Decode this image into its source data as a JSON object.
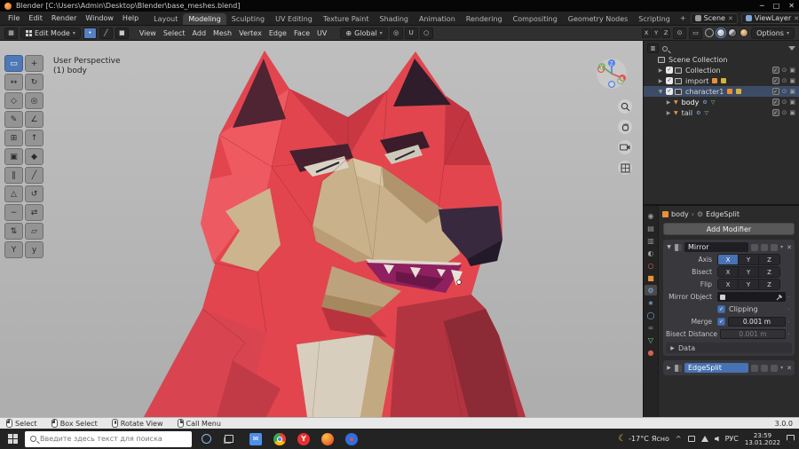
{
  "window": {
    "title": "Blender [C:\\Users\\Admin\\Desktop\\Blender\\base_meshes.blend]",
    "minimize": "─",
    "maximize": "□",
    "close": "✕"
  },
  "topbar": {
    "menus": [
      "File",
      "Edit",
      "Render",
      "Window",
      "Help"
    ],
    "workspaces": [
      "Layout",
      "Modeling",
      "Sculpting",
      "UV Editing",
      "Texture Paint",
      "Shading",
      "Animation",
      "Rendering",
      "Compositing",
      "Geometry Nodes",
      "Scripting"
    ],
    "active_workspace": "Modeling",
    "add_tab": "+",
    "scene_label": "Scene",
    "viewlayer_label": "ViewLayer"
  },
  "header": {
    "mode": "Edit Mode",
    "menus": [
      "View",
      "Select",
      "Add",
      "Mesh",
      "Vertex",
      "Edge",
      "Face",
      "UV"
    ],
    "orientation": "Global",
    "mirror_axes": [
      "X",
      "Y",
      "Z"
    ],
    "options_label": "Options"
  },
  "viewport": {
    "overlay_line1": "User Perspective",
    "overlay_line2": "(1) body"
  },
  "tools": [
    {
      "name": "select-box",
      "glyph": "▭",
      "active": true
    },
    {
      "name": "cursor",
      "glyph": "+"
    },
    {
      "name": "move",
      "glyph": "↔"
    },
    {
      "name": "rotate",
      "glyph": "↻"
    },
    {
      "name": "scale",
      "glyph": "◇"
    },
    {
      "name": "transform",
      "glyph": "◎"
    },
    {
      "name": "annotate",
      "glyph": "✎"
    },
    {
      "name": "measure",
      "glyph": "∠"
    },
    {
      "name": "add-cube",
      "glyph": "⊞"
    },
    {
      "name": "extrude",
      "glyph": "↑"
    },
    {
      "name": "inset",
      "glyph": "▣"
    },
    {
      "name": "bevel",
      "glyph": "◆"
    },
    {
      "name": "loop-cut",
      "glyph": "‖"
    },
    {
      "name": "knife",
      "glyph": "╱"
    },
    {
      "name": "poly-build",
      "glyph": "△"
    },
    {
      "name": "spin",
      "glyph": "↺"
    },
    {
      "name": "smooth",
      "glyph": "∼"
    },
    {
      "name": "edge-slide",
      "glyph": "⇄"
    },
    {
      "name": "shrink-fatten",
      "glyph": "⇅"
    },
    {
      "name": "shear",
      "glyph": "▱"
    },
    {
      "name": "rip-region",
      "glyph": "Y"
    },
    {
      "name": "rip-edge",
      "glyph": "y"
    }
  ],
  "outliner": {
    "rows": [
      {
        "label": "Scene Collection",
        "level": 0,
        "expander": "",
        "icon": "collection",
        "right": false
      },
      {
        "label": "Collection",
        "level": 1,
        "expander": "▶",
        "icon": "collection",
        "checkbox": true,
        "right": true
      },
      {
        "label": "import",
        "level": 1,
        "expander": "▶",
        "icon": "collection",
        "checkbox": true,
        "badges": true,
        "right": true
      },
      {
        "label": "character1",
        "level": 1,
        "expander": "▼",
        "icon": "collection",
        "checkbox": true,
        "selected": true,
        "badges": true,
        "right": true
      },
      {
        "label": "body",
        "level": 2,
        "expander": "▶",
        "icon": "object",
        "active": true,
        "modbadges": true,
        "right": true
      },
      {
        "label": "tail",
        "level": 2,
        "expander": "▶",
        "icon": "object",
        "modbadges": true,
        "right": true
      }
    ]
  },
  "properties": {
    "tabs": [
      {
        "name": "render",
        "glyph": "◉",
        "color": "#9a9a9a"
      },
      {
        "name": "output",
        "glyph": "▤",
        "color": "#9a9a9a"
      },
      {
        "name": "view-layer",
        "glyph": "▥",
        "color": "#9a9a9a"
      },
      {
        "name": "scene",
        "glyph": "◐",
        "color": "#9a9a9a"
      },
      {
        "name": "world",
        "glyph": "○",
        "color": "#d86a5a"
      },
      {
        "name": "object",
        "glyph": "■",
        "color": "#e8913a"
      },
      {
        "name": "modifiers",
        "glyph": "⚙",
        "color": "#7db1f0",
        "active": true
      },
      {
        "name": "particles",
        "glyph": "∗",
        "color": "#8ab8e8"
      },
      {
        "name": "physics",
        "glyph": "◯",
        "color": "#8ab8e8"
      },
      {
        "name": "constraints",
        "glyph": "∞",
        "color": "#9a9a9a"
      },
      {
        "name": "data",
        "glyph": "▽",
        "color": "#8bd08b"
      },
      {
        "name": "material",
        "glyph": "●",
        "color": "#d8604f"
      }
    ],
    "breadcrumb_object": "body",
    "breadcrumb_sep": "›",
    "breadcrumb_modifier": "EdgeSplit",
    "add_modifier_label": "Add Modifier",
    "mirror": {
      "name": "Mirror",
      "axis_label": "Axis",
      "bisect_label": "Bisect",
      "flip_label": "Flip",
      "axes": [
        "X",
        "Y",
        "Z"
      ],
      "mirror_object_label": "Mirror Object",
      "clipping_label": "Clipping",
      "merge_label": "Merge",
      "merge_value": "0.001 m",
      "bisect_distance_label": "Bisect Distance",
      "bisect_distance_value": "0.001 m",
      "data_label": "Data"
    },
    "edgesplit_name": "EdgeSplit"
  },
  "statusbar": {
    "items": [
      {
        "label": "Select",
        "btn": "left"
      },
      {
        "label": "Box Select",
        "btn": "left"
      },
      {
        "label": "Rotate View",
        "btn": "mid"
      },
      {
        "label": "Call Menu",
        "btn": "right"
      }
    ],
    "version": "3.0.0"
  },
  "taskbar": {
    "search_placeholder": "Введите здесь текст для поиска",
    "apps": [
      "mail",
      "chrome",
      "yandex",
      "firefox",
      "browser"
    ],
    "weather_temp": "-17°C",
    "weather_desc": "Ясно",
    "lang": "РУС",
    "time": "23:59",
    "date": "13.01.2022"
  }
}
